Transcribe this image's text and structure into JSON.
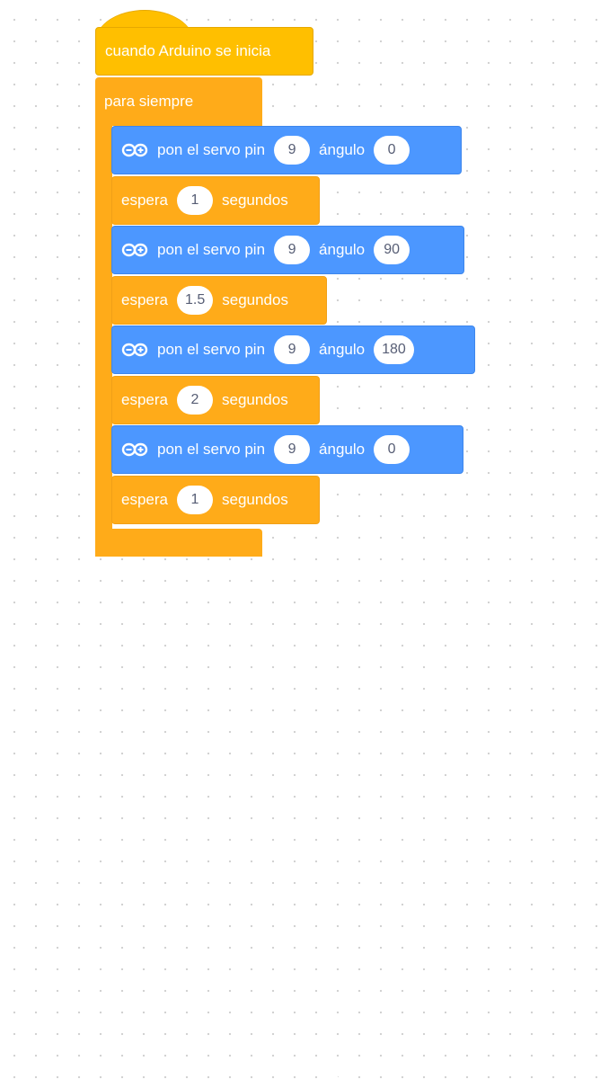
{
  "hat": {
    "label": "cuando Arduino se inicia"
  },
  "forever": {
    "label": "para siempre"
  },
  "blocks": [
    {
      "type": "servo",
      "text": "pon el servo pin",
      "pin": "9",
      "angle_label": "ángulo",
      "angle": "0"
    },
    {
      "type": "wait",
      "text": "espera",
      "value": "1",
      "unit": "segundos"
    },
    {
      "type": "servo",
      "text": "pon el servo pin",
      "pin": "9",
      "angle_label": "ángulo",
      "angle": "90"
    },
    {
      "type": "wait",
      "text": "espera",
      "value": "1.5",
      "unit": "segundos"
    },
    {
      "type": "servo",
      "text": "pon el servo pin",
      "pin": "9",
      "angle_label": "ángulo",
      "angle": "180"
    },
    {
      "type": "wait",
      "text": "espera",
      "value": "2",
      "unit": "segundos"
    },
    {
      "type": "servo",
      "text": "pon el servo pin",
      "pin": "9",
      "angle_label": "ángulo",
      "angle": "0"
    },
    {
      "type": "wait",
      "text": "espera",
      "value": "1",
      "unit": "segundos"
    }
  ],
  "colors": {
    "events": "#ffbf00",
    "control": "#ffab19",
    "servo": "#4c97ff",
    "input_text": "#575e75"
  },
  "icons": {
    "servo": "infinity-icon",
    "loop": "loop-arrow-icon"
  }
}
